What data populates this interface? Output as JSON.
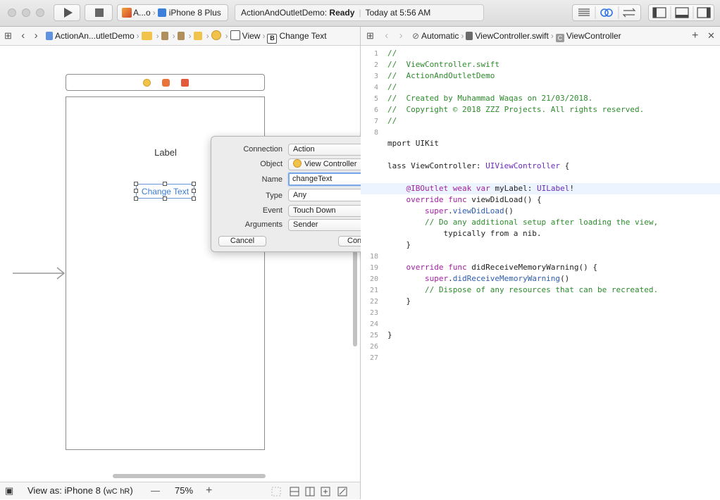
{
  "toolbar": {
    "scheme": "A...o",
    "device": "iPhone 8 Plus",
    "status_project": "ActionAndOutletDemo:",
    "status_state": "Ready",
    "status_time": "Today at 5:56 AM"
  },
  "left_jumpbar": {
    "items": [
      "ActionAn...utletDemo",
      "View",
      "Change Text"
    ]
  },
  "right_jumpbar": {
    "mode": "Automatic",
    "file": "ViewController.swift",
    "symbol": "ViewController"
  },
  "canvas": {
    "label_text": "Label",
    "button_text": "Change Text"
  },
  "popover": {
    "connection_label": "Connection",
    "connection_value": "Action",
    "object_label": "Object",
    "object_value": "View Controller",
    "name_label": "Name",
    "name_value": "changeText",
    "type_label": "Type",
    "type_value": "Any",
    "event_label": "Event",
    "event_value": "Touch Down",
    "arguments_label": "Arguments",
    "arguments_value": "Sender",
    "cancel": "Cancel",
    "connect": "Connect"
  },
  "bottom": {
    "view_as": "View as: iPhone 8",
    "size_w": "wC",
    "size_h": "hR",
    "zoom_minus": "—",
    "zoom": "75%",
    "zoom_plus": "+"
  },
  "editor": {
    "lines": [
      {
        "n": "1",
        "t": "//"
      },
      {
        "n": "2",
        "t": "//  ViewController.swift"
      },
      {
        "n": "3",
        "t": "//  ActionAndOutletDemo"
      },
      {
        "n": "4",
        "t": "//"
      },
      {
        "n": "5",
        "t": "//  Created by Muhammad Waqas on 21/03/2018."
      },
      {
        "n": "6",
        "t": "//  Copyright © 2018 ZZZ Projects. All rights reserved."
      },
      {
        "n": "7",
        "t": "//"
      },
      {
        "n": "8",
        "t": ""
      },
      {
        "n": "",
        "t": "mport UIKit"
      },
      {
        "n": "",
        "t": ""
      },
      {
        "n": "",
        "t": "lass ViewController: UIViewController {"
      },
      {
        "n": "",
        "t": ""
      },
      {
        "n": "",
        "t": "    @IBOutlet weak var myLabel: UILabel!"
      },
      {
        "n": "",
        "t": "    override func viewDidLoad() {"
      },
      {
        "n": "",
        "t": "        super.viewDidLoad()"
      },
      {
        "n": "",
        "t": "        // Do any additional setup after loading the view,"
      },
      {
        "n": "",
        "t": "            typically from a nib."
      },
      {
        "n": "",
        "t": "    }"
      },
      {
        "n": "18",
        "t": ""
      },
      {
        "n": "19",
        "t": "    override func didReceiveMemoryWarning() {"
      },
      {
        "n": "20",
        "t": "        super.didReceiveMemoryWarning()"
      },
      {
        "n": "21",
        "t": "        // Dispose of any resources that can be recreated."
      },
      {
        "n": "22",
        "t": "    }"
      },
      {
        "n": "23",
        "t": ""
      },
      {
        "n": "24",
        "t": ""
      },
      {
        "n": "25",
        "t": "}"
      },
      {
        "n": "26",
        "t": ""
      },
      {
        "n": "27",
        "t": ""
      }
    ]
  }
}
